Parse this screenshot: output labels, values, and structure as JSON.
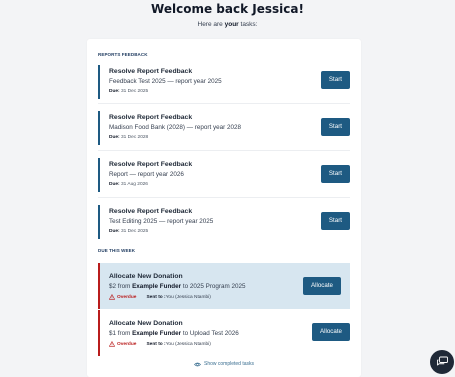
{
  "header": {
    "welcome": "Welcome back Jessica!",
    "subtitle_prefix": "Here are ",
    "subtitle_bold": "your",
    "subtitle_suffix": " tasks:"
  },
  "sections": {
    "reports_feedback": "REPORTS FEEDBACK",
    "due_this_week": "DUE THIS WEEK"
  },
  "report_tasks": [
    {
      "title": "Resolve Report Feedback",
      "subtitle": "Feedback Test 2025 — report year 2025",
      "due_label": "Due:",
      "due_date": "31 Dec 2025",
      "action": "Start"
    },
    {
      "title": "Resolve Report Feedback",
      "subtitle": "Madison Food Bank (2028) — report year 2028",
      "due_label": "Due:",
      "due_date": "31 Dec 2028",
      "action": "Start"
    },
    {
      "title": "Resolve Report Feedback",
      "subtitle": "Report — report year 2026",
      "due_label": "Due:",
      "due_date": "31 Aug 2026",
      "action": "Start"
    },
    {
      "title": "Resolve Report Feedback",
      "subtitle": "Test Editing 2025 — report year 2025",
      "due_label": "Due:",
      "due_date": "31 Dec 2025",
      "action": "Start"
    }
  ],
  "donation_tasks": [
    {
      "title": "Allocate New Donation",
      "amount": "$2 from ",
      "funder": "Example Funder",
      "target": " to 2025 Program 2025",
      "status": "Overdue",
      "sent_label": "Sent to :",
      "sent_to": " You (Jessica Ntambi)",
      "action": "Allocate"
    },
    {
      "title": "Allocate New Donation",
      "amount": "$1 from ",
      "funder": "Example Funder",
      "target": " to Upload Test 2026",
      "status": "Overdue",
      "sent_label": "Sent to :",
      "sent_to": " You (Jessica Ntambi)",
      "action": "Allocate"
    }
  ],
  "footer": {
    "show_completed": "Show completed tasks"
  },
  "colors": {
    "primary": "#1e5a82",
    "danger": "#b91c1c",
    "highlight": "#d7e6f0"
  }
}
